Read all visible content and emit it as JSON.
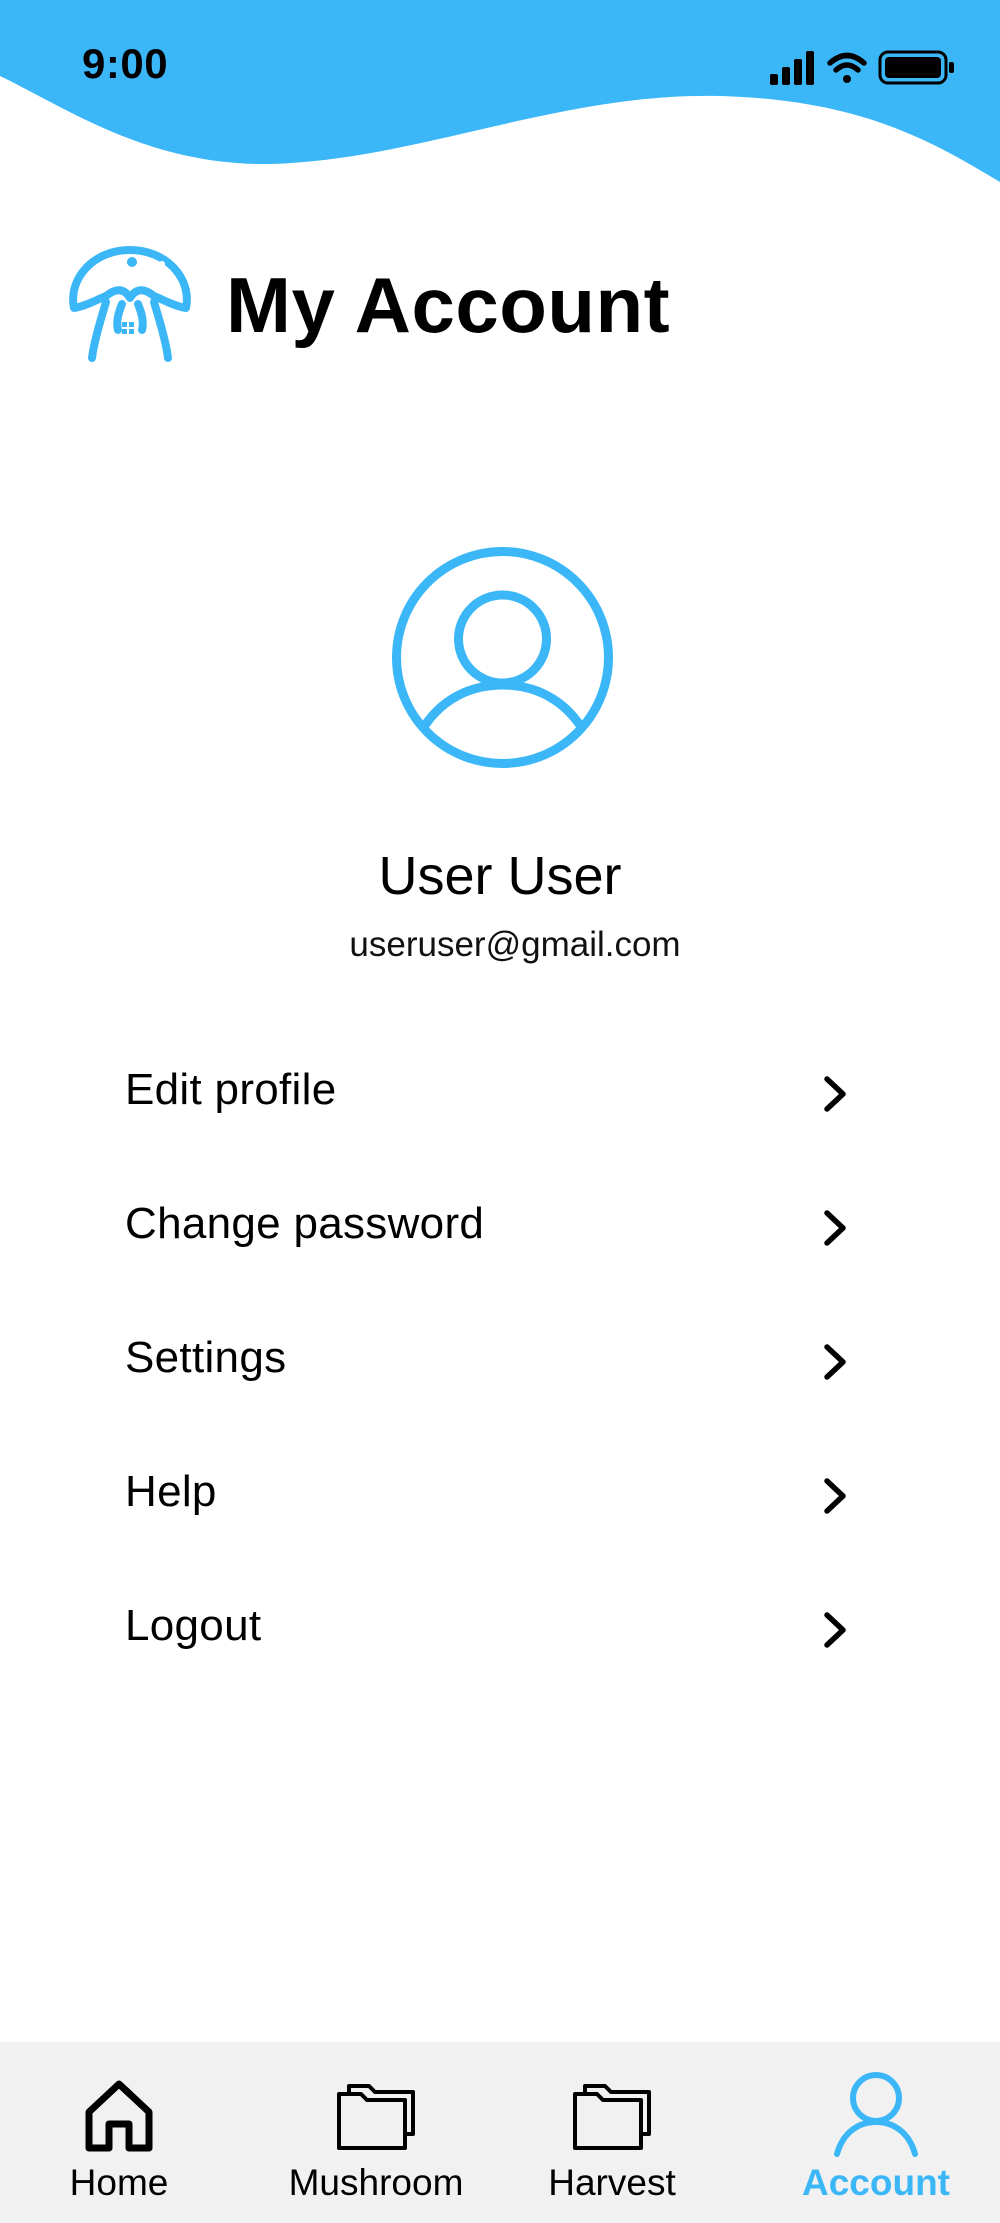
{
  "status_bar": {
    "time": "9:00",
    "icons": [
      "cellular-signal-icon",
      "wifi-icon",
      "battery-icon"
    ]
  },
  "header": {
    "logo": "mushroom-house-logo",
    "title": "My Account"
  },
  "profile": {
    "avatar_icon": "user-circle-icon",
    "name": "User User",
    "email": "useruser@gmail.com"
  },
  "menu": {
    "items": [
      {
        "label": "Edit profile",
        "icon": "chevron-right-icon"
      },
      {
        "label": "Change password",
        "icon": "chevron-right-icon"
      },
      {
        "label": "Settings",
        "icon": "chevron-right-icon"
      },
      {
        "label": "Help",
        "icon": "chevron-right-icon"
      },
      {
        "label": "Logout",
        "icon": "chevron-right-icon"
      }
    ]
  },
  "bottom_nav": {
    "items": [
      {
        "label": "Home",
        "icon": "home-icon",
        "active": false
      },
      {
        "label": "Mushroom",
        "icon": "folder-icon",
        "active": false
      },
      {
        "label": "Harvest",
        "icon": "folder-icon",
        "active": false
      },
      {
        "label": "Account",
        "icon": "user-icon",
        "active": true
      }
    ]
  },
  "colors": {
    "accent": "#3bb7f8",
    "text": "#000000",
    "background": "#ffffff",
    "nav_background": "#f1f1f1"
  }
}
